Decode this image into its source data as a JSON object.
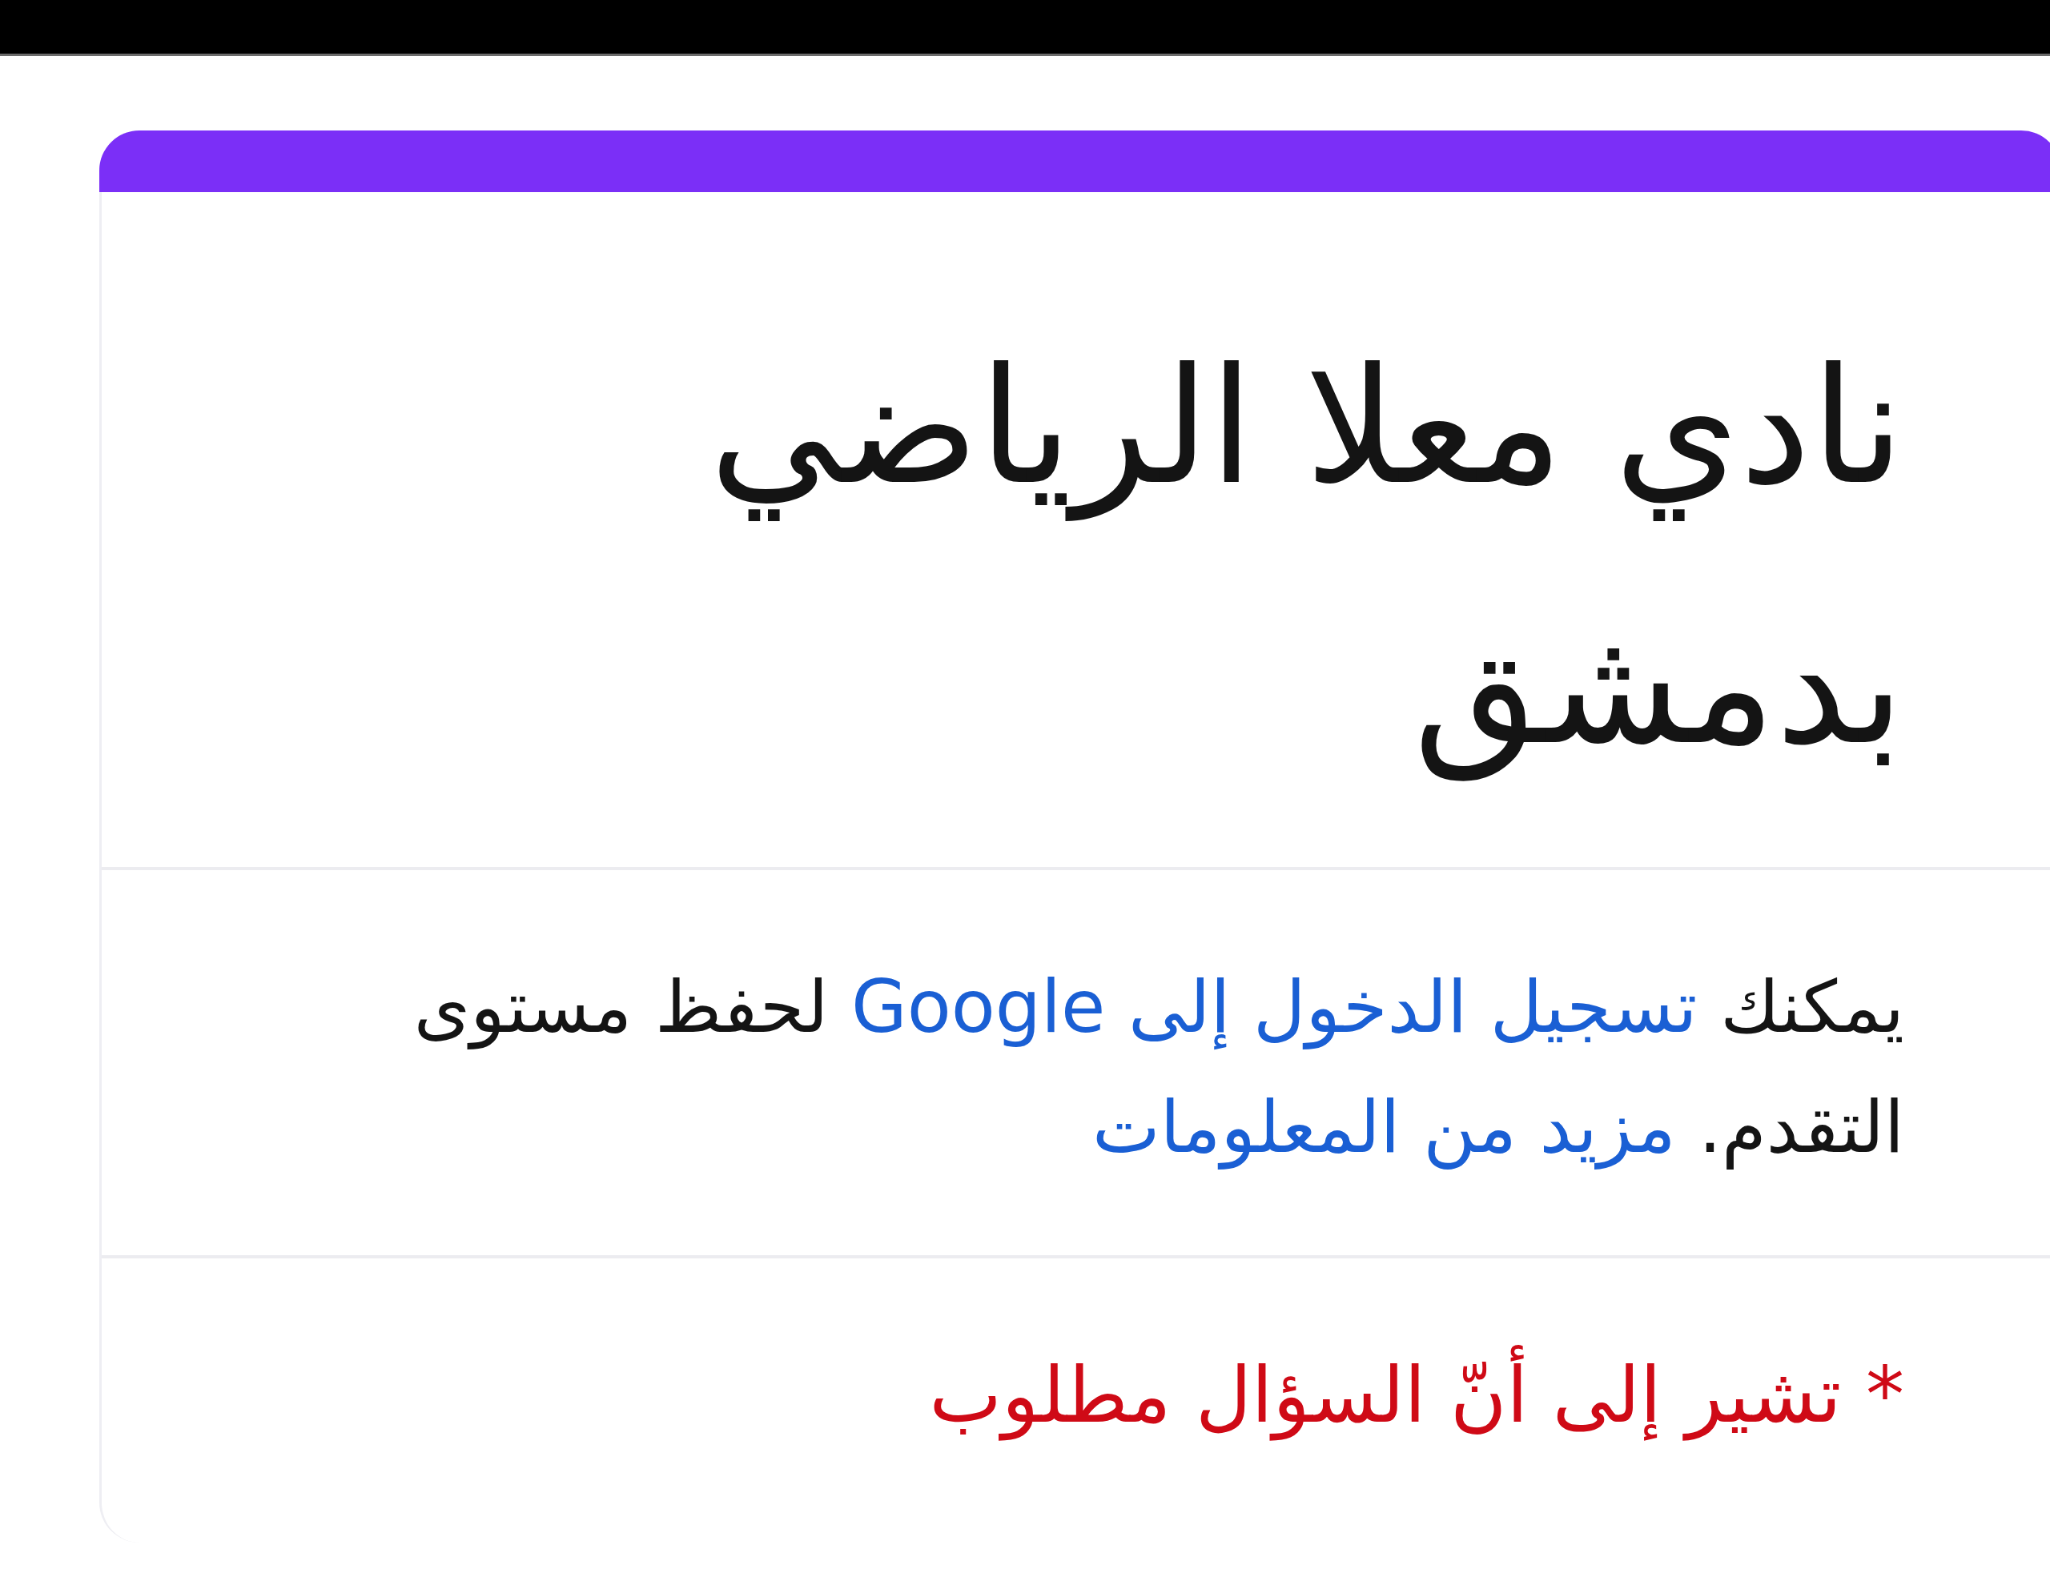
{
  "form": {
    "title": "نادي معلا الرياضي بدمشق",
    "notice": [
      {
        "kind": "text",
        "text": "يمكنك"
      },
      {
        "kind": "link",
        "text": "تسجيل الدخول إلى Google"
      },
      {
        "kind": "text",
        "text": "لحفظ مستوى التقدم."
      },
      {
        "kind": "link",
        "text": "مزيد من المعلومات"
      }
    ],
    "required_note": "* تشير إلى أنّ السؤال مطلوب"
  }
}
